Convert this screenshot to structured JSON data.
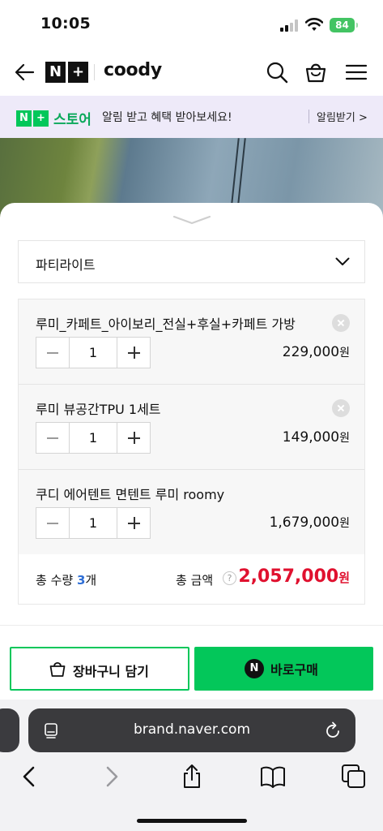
{
  "status_bar": {
    "time": "10:05",
    "battery": "84"
  },
  "header": {
    "brand_badge": [
      "N",
      "+"
    ],
    "brand_name": "coody"
  },
  "banner": {
    "store_badge": [
      "N",
      "+"
    ],
    "store_name": "스토어",
    "message": "알림 받고 혜택 받아보세요!",
    "button_label": "알림받기 >"
  },
  "option_select": {
    "value": "파티라이트"
  },
  "cart_items": [
    {
      "name": "루미_카페트_아이보리_전실+후실+카페트 가방",
      "quantity": "1",
      "price": "229,000",
      "currency": "원",
      "removable": true
    },
    {
      "name": "루미 뷰공간TPU 1세트",
      "quantity": "1",
      "price": "149,000",
      "currency": "원",
      "removable": true
    },
    {
      "name": "쿠디 에어텐트 면텐트 루미 roomy",
      "quantity": "1",
      "price": "1,679,000",
      "currency": "원",
      "removable": false
    }
  ],
  "totals": {
    "qty_label": "총 수량",
    "qty_value": "3",
    "qty_unit": "개",
    "amount_label": "총 금액",
    "help_glyph": "?",
    "amount_value": "2,057,000",
    "amount_unit": "원"
  },
  "actions": {
    "cart_label": "장바구니 담기",
    "buy_badge": "N",
    "buy_label": "바로구매"
  },
  "browser": {
    "url": "brand.naver.com"
  },
  "colors": {
    "naver_green": "#03c75a",
    "total_red": "#e0112f",
    "qty_blue": "#2f6fd6",
    "banner_bg": "#eeeaf9"
  }
}
